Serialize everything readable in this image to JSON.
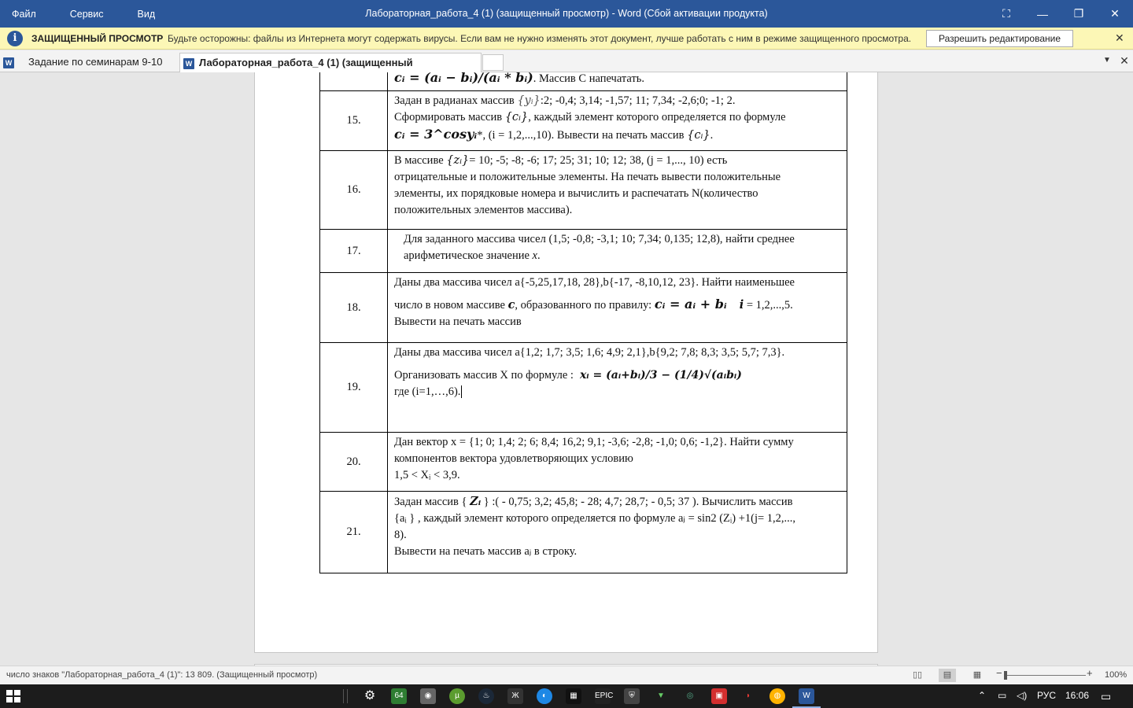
{
  "window": {
    "menu": [
      "Файл",
      "Сервис",
      "Вид"
    ],
    "title": "Лабораторная_работа_4 (1) (защищенный просмотр) - Word (Сбой активации продукта)",
    "controls": {
      "focus": "⛶",
      "minimize": "—",
      "restore": "❐",
      "close": "✕"
    }
  },
  "protected_bar": {
    "icon": "i",
    "label": "ЗАЩИЩЕННЫЙ ПРОСМОТР",
    "message": "Будьте осторожны: файлы из Интернета могут содержать вирусы. Если вам не нужно изменять этот документ, лучше работать с ним в режиме защищенного просмотра.",
    "enable_button": "Разрешить редактирование",
    "close": "✕"
  },
  "tabs": {
    "items": [
      {
        "label": "Задание по семинарам 9-10"
      },
      {
        "label": "Лабораторная_работа_4 (1) (защищенный просмотр)"
      }
    ],
    "word_icon": "W",
    "close": "✕",
    "dropdown": "▼"
  },
  "document": {
    "row_top": {
      "formula": "cᵢ = (aᵢ − bᵢ)/(aᵢ * bᵢ)",
      "text": ". Массив С напечатать."
    },
    "rows": [
      {
        "num": "15.",
        "l1a": "Задан в радианах массив ",
        "l1m": "{yᵢ}",
        "l1b": ":2; -0,4; 3,14; -1,57; 11; 7,34; -2,6;0; -1; 2.",
        "l2a": "Сформировать массив ",
        "l2m": "{cᵢ}",
        "l2b": ", каждый элемент которого определяется по формуле",
        "l3m": "cᵢ = 3^cosyᵢ",
        "l3b": "*, (i = 1,2,...,10).  Вывести на печать массив ",
        "l3m2": "{cᵢ}",
        "l3c": "."
      },
      {
        "num": "16.",
        "l1a": "В массиве ",
        "l1m": "{zᵢ}",
        "l1b": "= 10; -5; -8; -6; 17; 25; 31; 10; 12; 38, (j = 1,..., 10) есть",
        "l2": "отрицательные и положительные элементы. На печать вывести положительные",
        "l3": "элементы, их порядковые номера и вычислить и распечатать  N(количество",
        "l4": "положительных элементов массива)."
      },
      {
        "num": "17.",
        "l1": "Для заданного массива чисел (1,5; -0,8; -3,1; 10; 7,34; 0,135; 12,8), найти среднее",
        "l2a": "арифметическое значение ",
        "l2m": "x",
        "l2b": "."
      },
      {
        "num": "18.",
        "l1": "Даны два массива чисел а{-5,25,17,18, 28},b{-17, -8,10,12, 23}. Найти наименьшее",
        "l2a": "число в новом массиве ",
        "l2m": "c",
        "l2b": ", образованного по правилу: ",
        "l2f": "cᵢ = aᵢ + bᵢ",
        "l2i": "i",
        "l2c": " = 1,2,...,5.",
        "l3": "Вывести на печать  массив"
      },
      {
        "num": "19.",
        "l1": "Даны два массива чисел а{1,2; 1,7; 3,5; 1,6; 4,9; 2,1},b{9,2; 7,8; 8,3; 3,5; 5,7; 7,3}.",
        "l2": "Организовать массив Х по формуле :",
        "formula": "xᵢ = (aᵢ+bᵢ)/3 − (1/4)√(aᵢbᵢ)",
        "l3": "где     (i=1,…,6)."
      },
      {
        "num": "20.",
        "l1": "Дан вектор x = {1; 0; 1,4; 2; 6; 8,4; 16,2; 9,1; -3,6; -2,8; -1,0; 0,6; -1,2}. Найти сумму",
        "l2": "компонентов вектора удовлетворяющих условию",
        "l3": "1,5 < Xᵢ  < 3,9."
      },
      {
        "num": "21.",
        "l1a": "Задан массив { ",
        "l1m": "Zᵢ",
        "l1b": " } :( - 0,75; 3,2; 45,8; - 28; 4,7; 28,7; - 0,5; 37 ). Вычислить массив",
        "l2": "{aᵢ } , каждый элемент которого определяется по формуле   aⱼ = sin2 (Zᵢ) +1(j= 1,2,...,",
        "l3": "8).",
        "l4": " Вывести на печать  массив aⱼ в строку."
      }
    ]
  },
  "status": {
    "text": "число знаков \"Лабораторная_работа_4 (1)\": 13 809. (Защищенный просмотр)",
    "zoom": "100%",
    "zoom_level_percent": 100
  },
  "taskbar": {
    "lang": "РУС",
    "time": "16:06"
  }
}
